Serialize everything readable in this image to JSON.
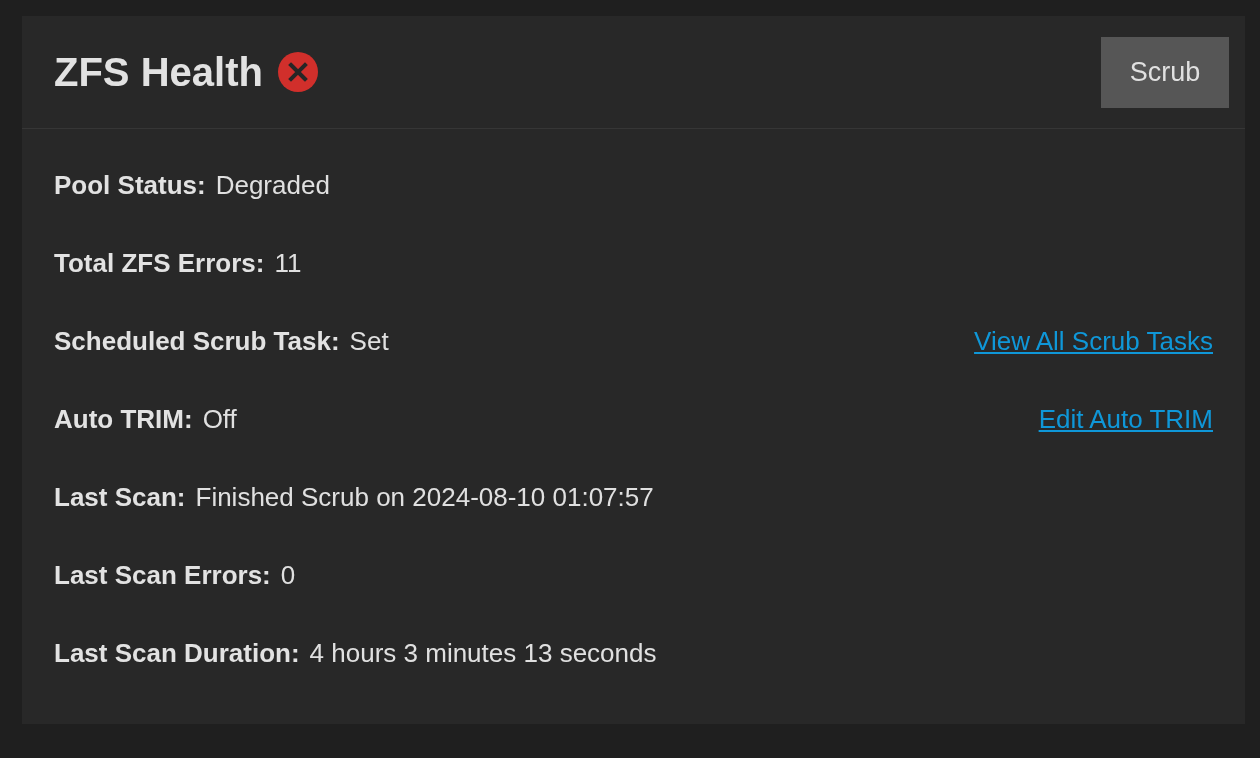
{
  "card": {
    "title": "ZFS Health",
    "error": true,
    "button": "Scrub"
  },
  "rows": [
    {
      "label": "Pool Status:",
      "value": "Degraded"
    },
    {
      "label": "Total ZFS Errors:",
      "value": "11"
    },
    {
      "label": "Scheduled Scrub Task:",
      "value": "Set",
      "link": "View All Scrub Tasks"
    },
    {
      "label": "Auto TRIM:",
      "value": "Off",
      "link": "Edit Auto TRIM"
    },
    {
      "label": "Last Scan:",
      "value": "Finished Scrub on 2024-08-10 01:07:57"
    },
    {
      "label": "Last Scan Errors:",
      "value": "0"
    },
    {
      "label": "Last Scan Duration:",
      "value": "4 hours 3 minutes 13 seconds"
    }
  ]
}
